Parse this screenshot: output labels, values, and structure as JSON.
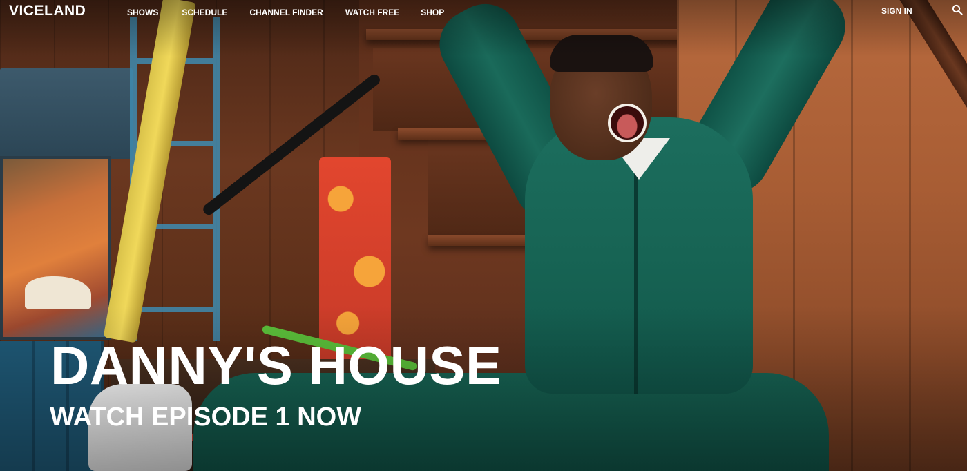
{
  "brand": {
    "logo_text": "VICELAND"
  },
  "nav": {
    "items": [
      {
        "label": "SHOWS"
      },
      {
        "label": "SCHEDULE"
      },
      {
        "label": "CHANNEL FINDER"
      },
      {
        "label": "WATCH FREE"
      },
      {
        "label": "SHOP"
      }
    ],
    "sign_in_label": "SIGN IN",
    "search_icon": "search-icon"
  },
  "hero": {
    "title": "DANNY'S HOUSE",
    "cta": "WATCH EPISODE 1 NOW",
    "image_subject": "man in green tracksuit cheering on wooden stairs"
  },
  "colors": {
    "text": "#ffffff",
    "tracksuit": "#176454",
    "wood": "#a85d34"
  }
}
